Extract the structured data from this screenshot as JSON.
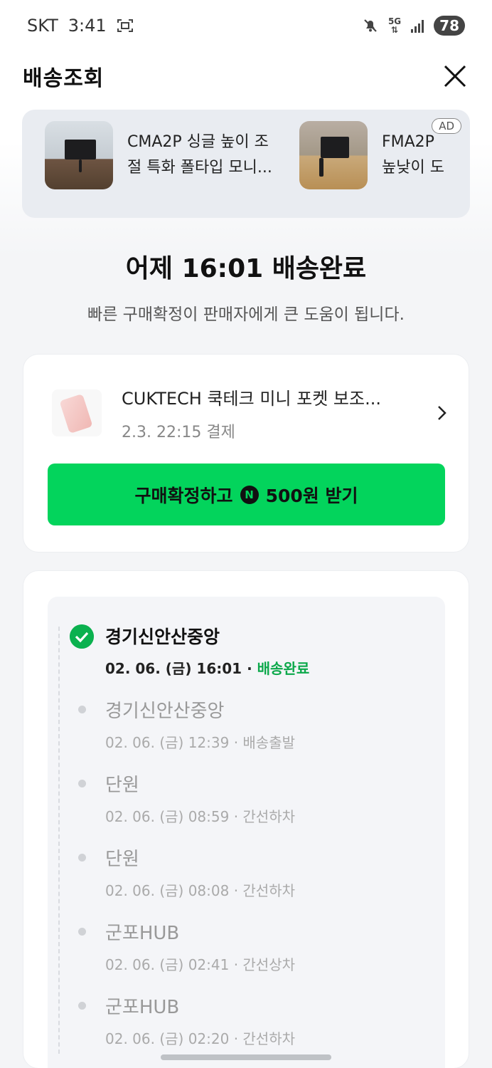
{
  "status_bar": {
    "carrier": "SKT",
    "time": "3:41",
    "network": "5G",
    "battery": "78"
  },
  "header": {
    "title": "배송조회"
  },
  "ad_banner": {
    "badge": "AD",
    "items": [
      {
        "title_line1": "CMA2P 싱글 높이 조",
        "title_line2": "절 특화 폴타입 모니..."
      },
      {
        "title_line1": "FMA2P",
        "title_line2": "높낮이 도"
      }
    ]
  },
  "delivery": {
    "headline": "어제 16:01 배송완료",
    "subline": "빠른 구매확정이 판매자에게 큰 도움이 됩니다."
  },
  "product": {
    "name": "CUKTECH 쿡테크 미니 포켓 보조...",
    "paid_at": "2.3. 22:15 결제",
    "confirm_label_prefix": "구매확정하고",
    "npay_symbol": "N",
    "confirm_label_suffix": "500원 받기"
  },
  "tracking": [
    {
      "location": "경기신안산중앙",
      "datetime": "02. 06. (금) 16:01",
      "status": "배송완료"
    },
    {
      "location": "경기신안산중앙",
      "datetime": "02. 06. (금) 12:39",
      "status": "배송출발"
    },
    {
      "location": "단원",
      "datetime": "02. 06. (금) 08:59",
      "status": "간선하차"
    },
    {
      "location": "단원",
      "datetime": "02. 06. (금) 08:08",
      "status": "간선하차"
    },
    {
      "location": "군포HUB",
      "datetime": "02. 06. (금) 02:41",
      "status": "간선상차"
    },
    {
      "location": "군포HUB",
      "datetime": "02. 06. (금) 02:20",
      "status": "간선하차"
    }
  ],
  "separator": "·",
  "colors": {
    "accent_green": "#03d45c",
    "status_green": "#0ba84a",
    "check_green": "#0bb14f"
  }
}
